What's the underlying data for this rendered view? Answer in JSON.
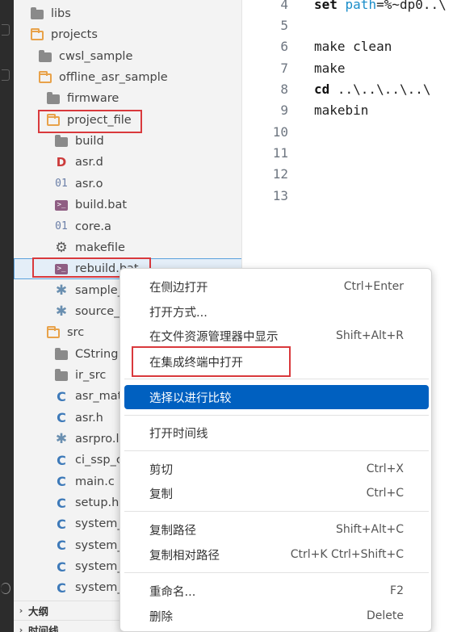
{
  "explorer": {
    "items": [
      {
        "label": "libs",
        "icon": "folder-icon"
      },
      {
        "label": "projects",
        "icon": "folder-open-icon"
      },
      {
        "label": "cwsl_sample",
        "icon": "folder-icon"
      },
      {
        "label": "offline_asr_sample",
        "icon": "folder-open-icon"
      },
      {
        "label": "firmware",
        "icon": "folder-icon"
      },
      {
        "label": "project_file",
        "icon": "folder-open-icon"
      },
      {
        "label": "build",
        "icon": "folder-icon"
      },
      {
        "label": "asr.d",
        "icon": "d-file-icon",
        "glyph": "D"
      },
      {
        "label": "asr.o",
        "icon": "binary-file-icon",
        "glyph": "01"
      },
      {
        "label": "build.bat",
        "icon": "terminal-file-icon",
        "glyph": ">_"
      },
      {
        "label": "core.a",
        "icon": "binary-file-icon",
        "glyph": "01"
      },
      {
        "label": "makefile",
        "icon": "gear-icon",
        "glyph": "⚙"
      },
      {
        "label": "rebuild.bat",
        "icon": "terminal-file-icon",
        "glyph": ">_"
      },
      {
        "label": "sample_",
        "icon": "asterisk-file-icon",
        "glyph": "✱"
      },
      {
        "label": "source_",
        "icon": "asterisk-file-icon",
        "glyph": "✱"
      },
      {
        "label": "src",
        "icon": "folder-open-icon"
      },
      {
        "label": "CString",
        "icon": "folder-icon"
      },
      {
        "label": "ir_src",
        "icon": "folder-icon"
      },
      {
        "label": "asr_mat",
        "icon": "c-file-icon",
        "glyph": "C"
      },
      {
        "label": "asr.h",
        "icon": "c-file-icon",
        "glyph": "C"
      },
      {
        "label": "asrpro.l",
        "icon": "asterisk-file-icon",
        "glyph": "✱"
      },
      {
        "label": "ci_ssp_c",
        "icon": "c-file-icon",
        "glyph": "C"
      },
      {
        "label": "main.c",
        "icon": "c-file-icon",
        "glyph": "C"
      },
      {
        "label": "setup.h",
        "icon": "c-file-icon",
        "glyph": "C"
      },
      {
        "label": "system_",
        "icon": "c-file-icon",
        "glyph": "C"
      },
      {
        "label": "system_",
        "icon": "c-file-icon",
        "glyph": "C"
      },
      {
        "label": "system_",
        "icon": "c-file-icon",
        "glyph": "C"
      },
      {
        "label": "system_",
        "icon": "c-file-icon",
        "glyph": "C"
      }
    ],
    "outline_label": "大纲",
    "timeline_label": "时间线",
    "collapsed_glyph": "›"
  },
  "editor": {
    "lines": [
      {
        "num": "4",
        "kw": "set",
        "var": " path",
        "rest": "=%~dp0..\\"
      },
      {
        "num": "5",
        "kw": "",
        "var": "",
        "rest": ""
      },
      {
        "num": "6",
        "kw": "",
        "var": "",
        "rest": "make clean"
      },
      {
        "num": "7",
        "kw": "",
        "var": "",
        "rest": "make"
      },
      {
        "num": "8",
        "kw": "cd",
        "var": "",
        "rest": " ..\\..\\..\\..\\"
      },
      {
        "num": "9",
        "kw": "",
        "var": "",
        "rest": "makebin"
      },
      {
        "num": "10",
        "kw": "",
        "var": "",
        "rest": ""
      },
      {
        "num": "11",
        "kw": "",
        "var": "",
        "rest": ""
      },
      {
        "num": "12",
        "kw": "",
        "var": "",
        "rest": ""
      },
      {
        "num": "13",
        "kw": "",
        "var": "",
        "rest": ""
      }
    ]
  },
  "context_menu": {
    "items": [
      {
        "label": "在侧边打开",
        "shortcut": "Ctrl+Enter"
      },
      {
        "label": "打开方式...",
        "shortcut": ""
      },
      {
        "label": "在文件资源管理器中显示",
        "shortcut": "Shift+Alt+R"
      },
      {
        "label": "在集成终端中打开",
        "shortcut": ""
      },
      {
        "label": "选择以进行比较",
        "shortcut": ""
      },
      {
        "label": "打开时间线",
        "shortcut": ""
      },
      {
        "label": "剪切",
        "shortcut": "Ctrl+X"
      },
      {
        "label": "复制",
        "shortcut": "Ctrl+C"
      },
      {
        "label": "复制路径",
        "shortcut": "Shift+Alt+C"
      },
      {
        "label": "复制相对路径",
        "shortcut": "Ctrl+K Ctrl+Shift+C"
      },
      {
        "label": "重命名...",
        "shortcut": "F2"
      },
      {
        "label": "删除",
        "shortcut": "Delete"
      }
    ]
  },
  "colors": {
    "highlight": "#d9393c",
    "menu_active": "#0060c0",
    "folder_open": "#e8a24a",
    "sidebar_bg": "#f3f3f3"
  }
}
